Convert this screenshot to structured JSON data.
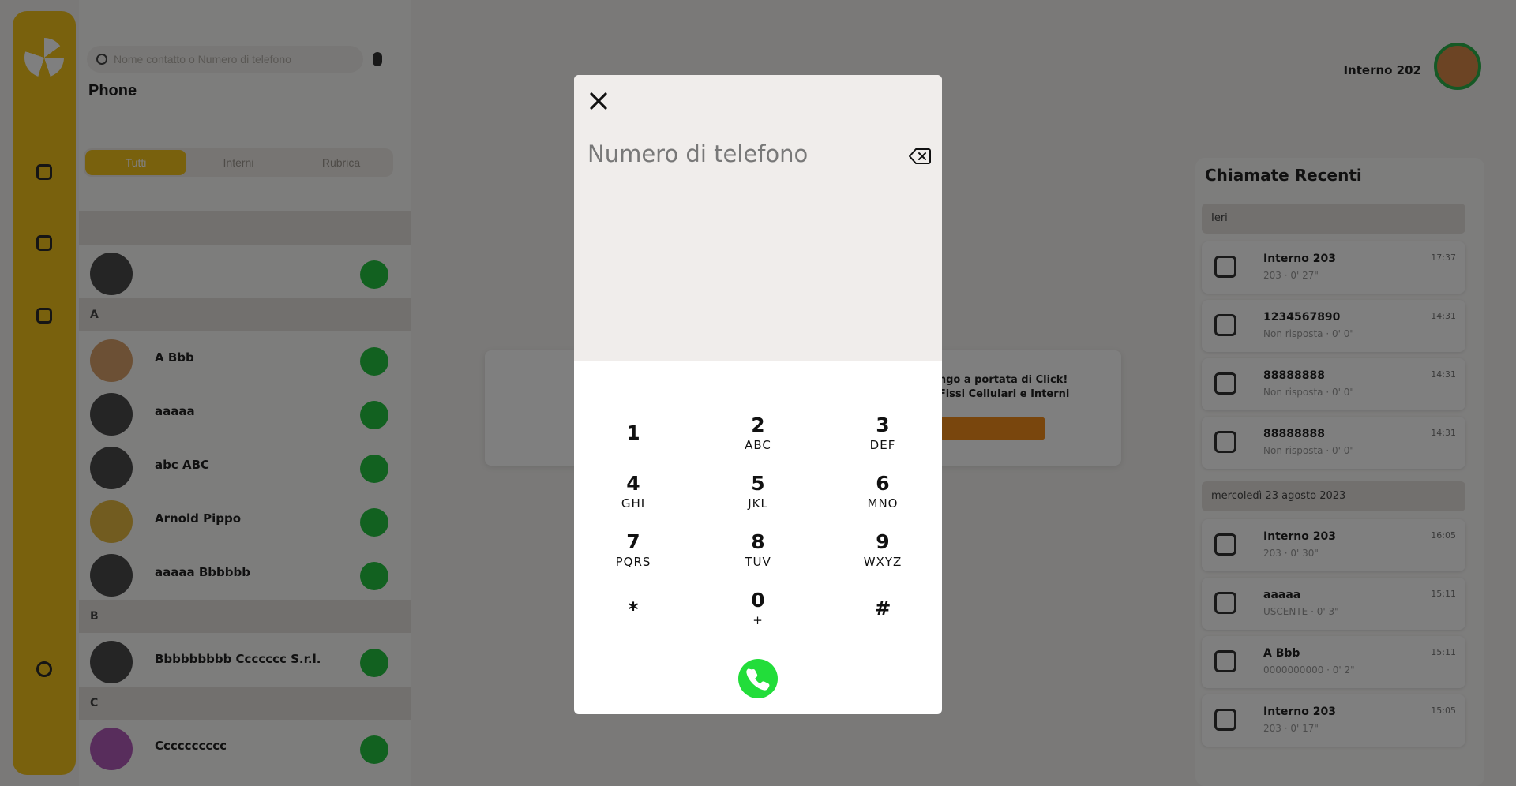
{
  "background": {
    "search_placeholder": "Nome contatto o Numero di telefono",
    "page_title": "Phone",
    "tabs": [
      "Tutti",
      "Interni",
      "Rubrica"
    ],
    "sections": [
      {
        "letter": "",
        "contacts": [
          ""
        ]
      },
      {
        "letter": "A",
        "contacts": [
          "A Bbb",
          "aaaaa",
          "abc ABC",
          "Arnold Pippo",
          "aaaaa Bbbbbb"
        ]
      },
      {
        "letter": "B",
        "contacts": [
          "Bbbbbbbbb Ccccccc S.r.l."
        ]
      },
      {
        "letter": "C",
        "contacts": [
          "Cccccccccc"
        ]
      }
    ],
    "user_name": "Interno 202",
    "recent_title": "Chiamate Recenti",
    "recent_sections": [
      {
        "label": "Ieri",
        "items": [
          {
            "name": "Interno 203",
            "sub": "203 · 0' 27\"",
            "time": "17:37"
          },
          {
            "name": "1234567890",
            "sub": "Non risposta · 0' 0\"",
            "time": "14:31"
          },
          {
            "name": "88888888",
            "sub": "Non risposta · 0' 0\"",
            "time": "14:31"
          },
          {
            "name": "88888888",
            "sub": "Non risposta · 0' 0\"",
            "time": "14:31"
          }
        ]
      },
      {
        "label": "mercoledì 23 agosto 2023",
        "items": [
          {
            "name": "Interno 203",
            "sub": "203 · 0' 30\"",
            "time": "16:05"
          },
          {
            "name": "aaaaa",
            "sub": "USCENTE · 0' 3\"",
            "time": "15:11"
          },
          {
            "name": "A Bbb",
            "sub": "0000000000 · 0' 2\"",
            "time": "15:11"
          },
          {
            "name": "Interno 203",
            "sub": "203 · 0' 17\"",
            "time": "15:05"
          }
        ]
      }
    ],
    "promo_line1": "...ngo a portata di Click!",
    "promo_line2": "...Fissi Cellulari e Interni"
  },
  "dialpad": {
    "close_glyph": "✕",
    "number_placeholder": "Numero di telefono",
    "number_value": "",
    "keys": [
      {
        "digit": "1",
        "letters": ""
      },
      {
        "digit": "2",
        "letters": "ABC"
      },
      {
        "digit": "3",
        "letters": "DEF"
      },
      {
        "digit": "4",
        "letters": "GHI"
      },
      {
        "digit": "5",
        "letters": "JKL"
      },
      {
        "digit": "6",
        "letters": "MNO"
      },
      {
        "digit": "7",
        "letters": "PQRS"
      },
      {
        "digit": "8",
        "letters": "TUV"
      },
      {
        "digit": "9",
        "letters": "WXYZ"
      },
      {
        "digit": "*",
        "letters": ""
      },
      {
        "digit": "0",
        "letters": "+"
      },
      {
        "digit": "#",
        "letters": ""
      }
    ],
    "call_color": "#22dd3a"
  },
  "icons": {
    "close": "close-icon",
    "backspace": "backspace-icon",
    "call": "phone-icon"
  }
}
